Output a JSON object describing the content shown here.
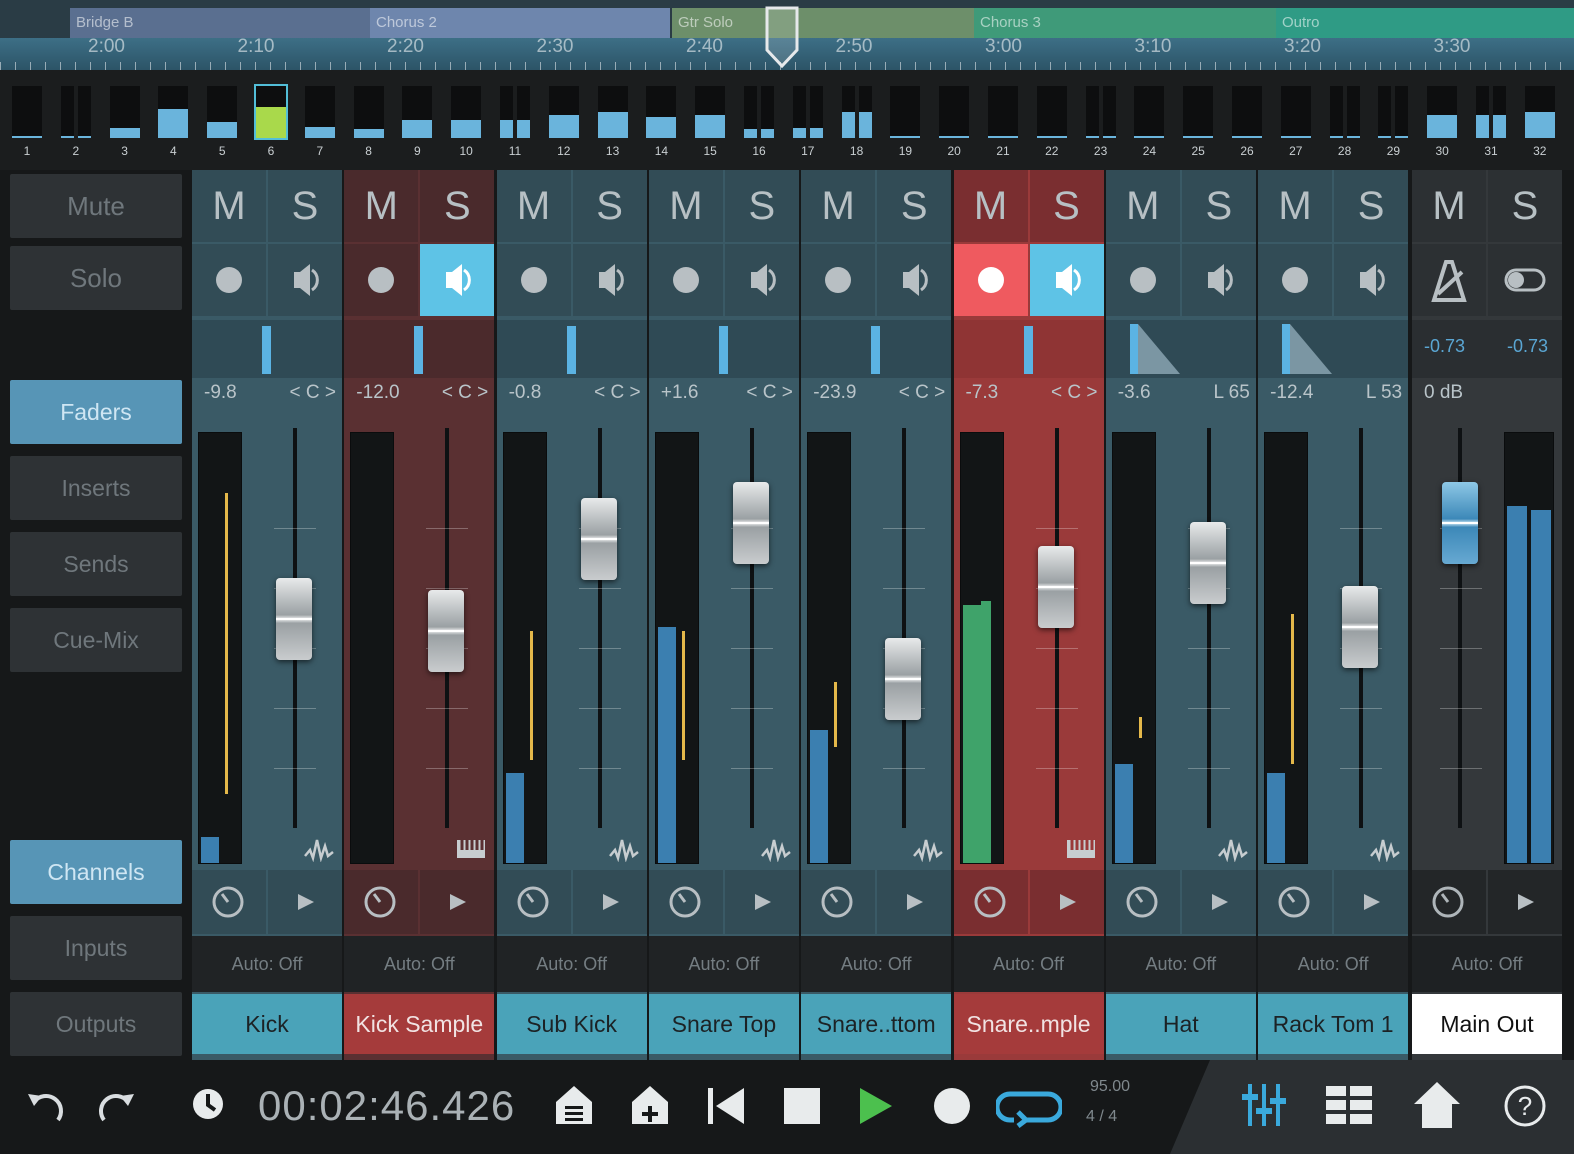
{
  "timeline": {
    "sections": [
      {
        "label": "Bridge B",
        "color": "#5a6f90"
      },
      {
        "label": "Chorus 2",
        "color": "#6e86ad"
      },
      {
        "label": "Gtr Solo",
        "color": "#6d8f6a"
      },
      {
        "label": "Chorus 3",
        "color": "#3f9a79"
      },
      {
        "label": "Outro",
        "color": "#2f9b85"
      }
    ],
    "ruler": [
      "2:00",
      "2:10",
      "2:20",
      "2:30",
      "2:40",
      "2:50",
      "3:00",
      "3:10",
      "3:20",
      "3:30"
    ]
  },
  "overview": {
    "channels": [
      "1",
      "2",
      "3",
      "4",
      "5",
      "6",
      "7",
      "8",
      "9",
      "10",
      "11",
      "12",
      "13",
      "14",
      "15",
      "16",
      "17",
      "18",
      "19",
      "20",
      "21",
      "22",
      "23",
      "24",
      "25",
      "26",
      "27",
      "28",
      "29",
      "30",
      "31",
      "32"
    ],
    "levels": [
      0.04,
      0.04,
      0.2,
      0.55,
      0.3,
      0.6,
      0.22,
      0.18,
      0.35,
      0.35,
      0.35,
      0.45,
      0.5,
      0.4,
      0.45,
      0.18,
      0.2,
      0.5,
      0,
      0,
      0,
      0,
      0,
      0.02,
      0.02,
      0.02,
      0.02,
      0,
      0.02,
      0.45,
      0.45,
      0.5
    ],
    "selected_channel": "6"
  },
  "sidebar": {
    "mute": "Mute",
    "solo": "Solo",
    "faders": "Faders",
    "inserts": "Inserts",
    "sends": "Sends",
    "cue_mix": "Cue-Mix",
    "channels": "Channels",
    "inputs": "Inputs",
    "outputs": "Outputs"
  },
  "strips": [
    {
      "name": "Kick",
      "m": "M",
      "s": "S",
      "volume": "-9.8",
      "pan": "< C >",
      "auto": "Auto: Off",
      "color": "#3a5a66",
      "name_color": "#4aa3b9",
      "record": false,
      "monitor": false,
      "fader": 0.6,
      "meter": 0.06,
      "peak": 0.7,
      "pan_pos": 0.5,
      "type": "audio"
    },
    {
      "name": "Kick Sample",
      "m": "M",
      "s": "S",
      "volume": "-12.0",
      "pan": "< C >",
      "auto": "Auto: Off",
      "color": "#5a3032",
      "name_color": "#a53b3b",
      "record": false,
      "monitor": true,
      "fader": 0.57,
      "meter": 0,
      "peak": 0,
      "pan_pos": 0.5,
      "type": "instrument"
    },
    {
      "name": "Sub Kick",
      "m": "M",
      "s": "S",
      "volume": "-0.8",
      "pan": "< C >",
      "auto": "Auto: Off",
      "color": "#3a5a66",
      "name_color": "#4aa3b9",
      "record": false,
      "monitor": false,
      "fader": 0.8,
      "meter": 0.21,
      "peak": 0.3,
      "pan_pos": 0.5,
      "type": "audio"
    },
    {
      "name": "Snare Top",
      "m": "M",
      "s": "S",
      "volume": "+1.6",
      "pan": "< C >",
      "auto": "Auto: Off",
      "color": "#3a5a66",
      "name_color": "#4aa3b9",
      "record": false,
      "monitor": false,
      "fader": 0.84,
      "meter": 0.55,
      "peak": 0.3,
      "pan_pos": 0.5,
      "type": "audio"
    },
    {
      "name": "Snare..ttom",
      "m": "M",
      "s": "S",
      "volume": "-23.9",
      "pan": "< C >",
      "auto": "Auto: Off",
      "color": "#3a5a66",
      "name_color": "#4aa3b9",
      "record": false,
      "monitor": false,
      "fader": 0.45,
      "meter": 0.31,
      "peak": 0.15,
      "pan_pos": 0.5,
      "type": "audio"
    },
    {
      "name": "Snare..mple",
      "m": "M",
      "s": "S",
      "volume": "-7.3",
      "pan": "< C >",
      "auto": "Auto: Off",
      "color": "#9a3a3a",
      "name_color": "#a53b3b",
      "record": true,
      "monitor": true,
      "fader": 0.68,
      "meter": 0.6,
      "peak": 0,
      "pan_pos": 0.5,
      "type": "instrument",
      "active": true
    },
    {
      "name": "Hat",
      "m": "M",
      "s": "S",
      "volume": "-3.6",
      "pan": "L 65",
      "auto": "Auto: Off",
      "color": "#3a5a66",
      "name_color": "#4aa3b9",
      "record": false,
      "monitor": false,
      "fader": 0.74,
      "meter": 0.23,
      "peak": 0.05,
      "pan_pos": 0.2,
      "type": "audio"
    },
    {
      "name": "Rack Tom 1",
      "m": "M",
      "s": "S",
      "volume": "-12.4",
      "pan": "L 53",
      "auto": "Auto: Off",
      "color": "#3a5a66",
      "name_color": "#4aa3b9",
      "record": false,
      "monitor": false,
      "fader": 0.58,
      "meter": 0.21,
      "peak": 0.35,
      "pan_pos": 0.25,
      "type": "audio"
    }
  ],
  "main_out": {
    "name": "Main Out",
    "m": "M",
    "s": "S",
    "volume": "0 dB",
    "left": "-0.73",
    "right": "-0.73",
    "auto": "Auto: Off",
    "fader": 0.84,
    "meter": 0.83
  },
  "transport": {
    "time": "00:02:46.426",
    "tempo": "95.00",
    "signature": "4  /  4"
  }
}
